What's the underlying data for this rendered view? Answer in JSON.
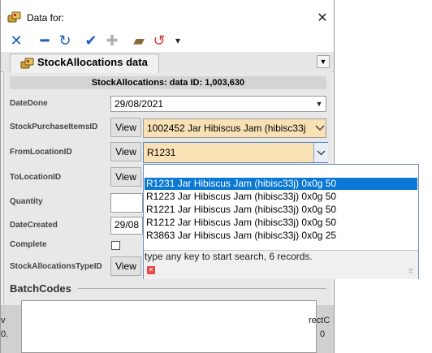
{
  "window": {
    "title": "Data for:"
  },
  "toolbar": {
    "buttons": [
      {
        "name": "cancel-icon",
        "glyph": "✕",
        "color": "#1f5fbf"
      },
      {
        "name": "remove-icon",
        "glyph": "━",
        "color": "#1f5fbf"
      },
      {
        "name": "refresh-icon",
        "glyph": "↻",
        "color": "#1f5fbf"
      },
      {
        "name": "check-icon",
        "glyph": "✔",
        "color": "#1f5fbf"
      },
      {
        "name": "add-icon",
        "glyph": "✚",
        "color": "#b0b0b0"
      },
      {
        "name": "eraser-icon",
        "glyph": "▰",
        "color": "#8a6a3a"
      },
      {
        "name": "undo-icon",
        "glyph": "↺",
        "color": "#d83b3b"
      },
      {
        "name": "dropdown-icon",
        "glyph": "▾",
        "color": "#222222"
      }
    ]
  },
  "tab": {
    "label": "StockAllocations data"
  },
  "header": {
    "text": "StockAllocations: data ID: 1,003,630"
  },
  "form": {
    "date_done_label": "DateDone",
    "date_done_value": "29/08/2021",
    "stock_purchase_items_label": "StockPurchaseItemsID",
    "stock_purchase_items_value": "1002452 Jar Hibiscus Jam  (hibisc33j",
    "from_location_label": "FromLocationID",
    "from_location_value": "R1231",
    "to_location_label": "ToLocationID",
    "quantity_label": "Quantity",
    "date_created_label": "DateCreated",
    "date_created_value": "29/08",
    "complete_label": "Complete",
    "type_label": "StockAllocationsTypeID",
    "view_label": "View",
    "batchcodes_label": "BatchCodes"
  },
  "fragments": {
    "left_a": "v",
    "left_b": "0.",
    "right_a": "rectC",
    "right_b": "0"
  },
  "popup": {
    "items": [
      "R1231 Jar Hibiscus Jam  (hibisc33j) 0x0g 50",
      "R1223 Jar Hibiscus Jam  (hibisc33j) 0x0g 50",
      "R1221 Jar Hibiscus Jam  (hibisc33j) 0x0g 50",
      "R1212 Jar Hibiscus Jam  (hibisc33j) 0x0g 50",
      "R3863 Jar Hibiscus Jam  (hibisc33j) 0x0g 25"
    ],
    "selected_index": 0,
    "status": "type any key to start search, 6 records."
  },
  "colors": {
    "selection": "#0a78d4",
    "lookup_field": "#f7e1b5",
    "panel": "#e8e8e8"
  }
}
